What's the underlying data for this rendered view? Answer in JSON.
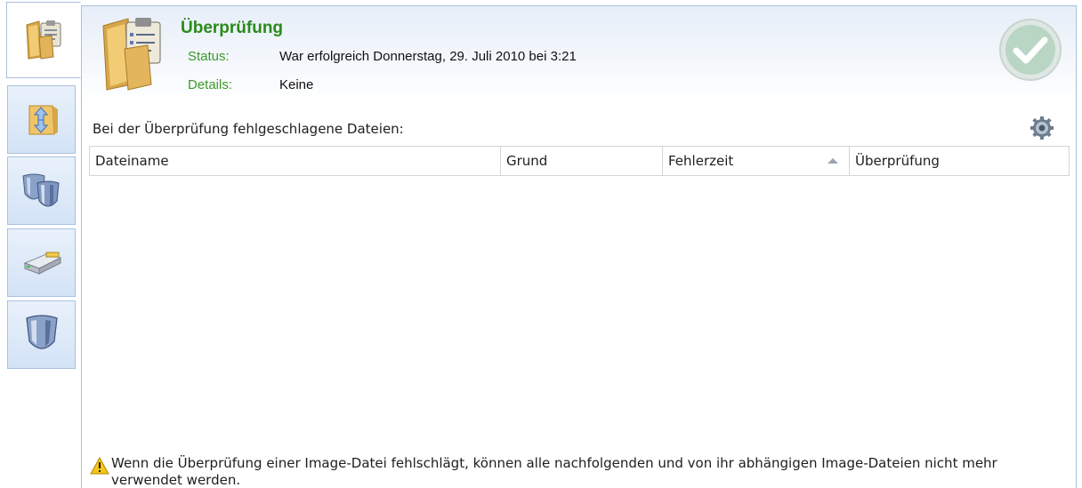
{
  "sidebar": {
    "tabs": [
      {
        "name": "verification",
        "icon": "folder-clipboard-icon",
        "active": true
      },
      {
        "name": "transfer",
        "icon": "folder-arrows-icon",
        "active": false
      },
      {
        "name": "protection-shields",
        "icon": "double-shield-icon",
        "active": false
      },
      {
        "name": "drive",
        "icon": "drive-icon",
        "active": false
      },
      {
        "name": "protection",
        "icon": "shield-icon",
        "active": false
      }
    ]
  },
  "header": {
    "title": "Überprüfung",
    "status_label": "Status:",
    "status_value": "War erfolgreich Donnerstag, 29. Juli 2010 bei 3:21",
    "details_label": "Details:",
    "details_value": "Keine",
    "status_icon": "success-check-icon"
  },
  "files": {
    "heading": "Bei der Überprüfung fehlgeschlagene Dateien:",
    "settings_icon": "gear-icon",
    "columns": [
      "Dateiname",
      "Grund",
      "Fehlerzeit",
      "Überprüfung"
    ],
    "sorted_column": "Fehlerzeit",
    "sort_direction": "ascending",
    "rows": []
  },
  "footer": {
    "warning_icon": "warning-icon",
    "warning_text": "Wenn die Überprüfung einer Image-Datei fehlschlägt, können alle nachfolgenden und von ihr abhängigen Image-Dateien nicht mehr verwendet werden."
  },
  "colors": {
    "title_green": "#2a8a1a",
    "label_green": "#3b9a2a",
    "border_blue": "#a9c1e0",
    "header_bg": "#e6eef8"
  }
}
